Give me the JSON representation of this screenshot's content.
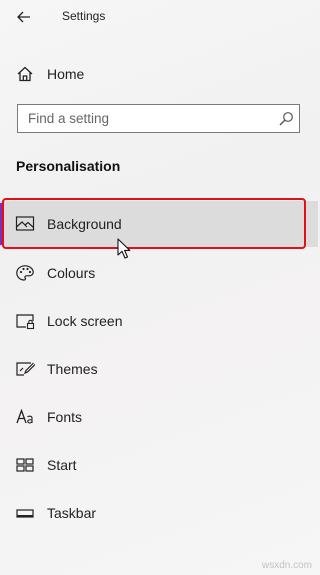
{
  "titlebar": {
    "title": "Settings",
    "back_icon": "back-arrow-icon"
  },
  "home": {
    "label": "Home",
    "icon": "home-icon"
  },
  "search": {
    "placeholder": "Find a setting",
    "icon": "search-icon"
  },
  "section": {
    "title": "Personalisation"
  },
  "nav": {
    "items": [
      {
        "label": "Background",
        "icon": "picture-icon",
        "selected": true
      },
      {
        "label": "Colours",
        "icon": "palette-icon"
      },
      {
        "label": "Lock screen",
        "icon": "lock-screen-icon"
      },
      {
        "label": "Themes",
        "icon": "themes-icon"
      },
      {
        "label": "Fonts",
        "icon": "fonts-icon"
      },
      {
        "label": "Start",
        "icon": "start-icon"
      },
      {
        "label": "Taskbar",
        "icon": "taskbar-icon"
      }
    ]
  },
  "watermark": "wsxdn.com",
  "colors": {
    "accent": "#7b2fbf",
    "highlight_border": "#e01018",
    "selected_bg": "#dcdcdc"
  }
}
